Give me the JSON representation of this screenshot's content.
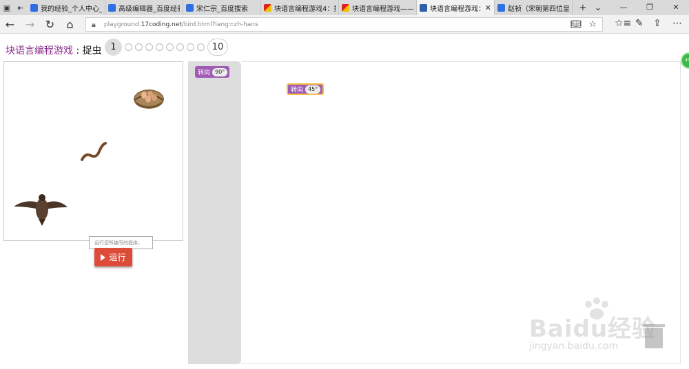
{
  "browser": {
    "tabs": [
      {
        "title": "我的经验_个人中心_百度",
        "icon": "paw-icon"
      },
      {
        "title": "高级编辑器_百度经验",
        "icon": "paw-icon"
      },
      {
        "title": "宋仁宗_百度搜索",
        "icon": "paw-icon"
      },
      {
        "title": "块语言编程游戏4：捉虫",
        "icon": "game-icon"
      },
      {
        "title": "块语言编程游戏——新问",
        "icon": "game-icon"
      },
      {
        "title": "块语言编程游戏：捉",
        "icon": "game-block-icon",
        "active": true
      },
      {
        "title": "赵祯（宋朝第四位皇帝",
        "icon": "paw-icon"
      }
    ],
    "url_prefix": "playground.",
    "url_domain": "17coding.net",
    "url_path": "/bird.html?lang=zh-hans"
  },
  "game": {
    "title": "块语言编程游戏",
    "separator": " : ",
    "subtitle": "捉虫",
    "current_level": "1",
    "last_level": "10",
    "level_dots": 8,
    "run_hint": "运行您所编写的程序。",
    "run_label": "运行"
  },
  "toolbox": {
    "block_label": "转向",
    "block_value": "90°"
  },
  "workspace": {
    "block_label": "转向",
    "block_value": "45°"
  },
  "watermark": {
    "text": "Baidu经验",
    "url": "jingyan.baidu.com"
  },
  "colors": {
    "block": "#a05cb5",
    "run_button": "#dd4b39",
    "title": "#8b2d8b",
    "toolbox_bg": "#dddddd"
  }
}
